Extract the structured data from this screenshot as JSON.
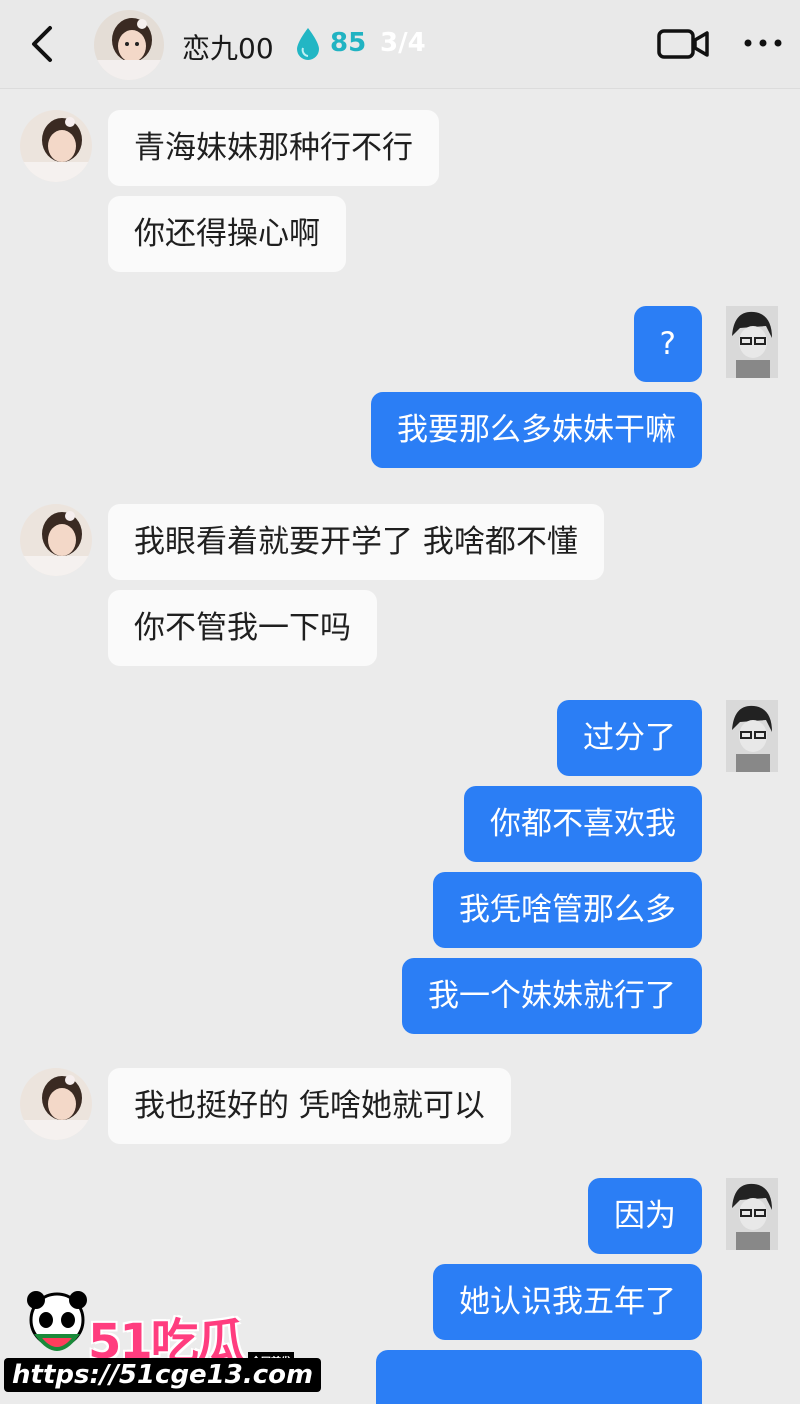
{
  "header": {
    "contact_name": "恋九00",
    "score": "85",
    "page_indicator": "3/4",
    "icons": [
      "back-icon",
      "drop-icon",
      "video-call-icon",
      "more-icon"
    ]
  },
  "messages": [
    {
      "side": "in",
      "text": "青海妹妹那种行不行"
    },
    {
      "side": "in",
      "text": "你还得操心啊"
    },
    {
      "side": "out",
      "text": "?"
    },
    {
      "side": "out",
      "text": "我要那么多妹妹干嘛"
    },
    {
      "side": "in",
      "text": "我眼看着就要开学了 我啥都不懂"
    },
    {
      "side": "in",
      "text": "你不管我一下吗"
    },
    {
      "side": "out",
      "text": "过分了"
    },
    {
      "side": "out",
      "text": "你都不喜欢我"
    },
    {
      "side": "out",
      "text": "我凭啥管那么多"
    },
    {
      "side": "out",
      "text": "我一个妹妹就行了"
    },
    {
      "side": "in",
      "text": "我也挺好的 凭啥她就可以"
    },
    {
      "side": "out",
      "text": "因为"
    },
    {
      "side": "out",
      "text": "她认识我五年了"
    }
  ],
  "watermark": {
    "logo_text": "51吃瓜",
    "tag": "全网首发",
    "url": "https://51cge13.com"
  },
  "colors": {
    "outgoing_bubble": "#2b7ef5",
    "incoming_bubble": "#fafafa",
    "background": "#ebebeb",
    "score_accent": "#21b3c2"
  }
}
